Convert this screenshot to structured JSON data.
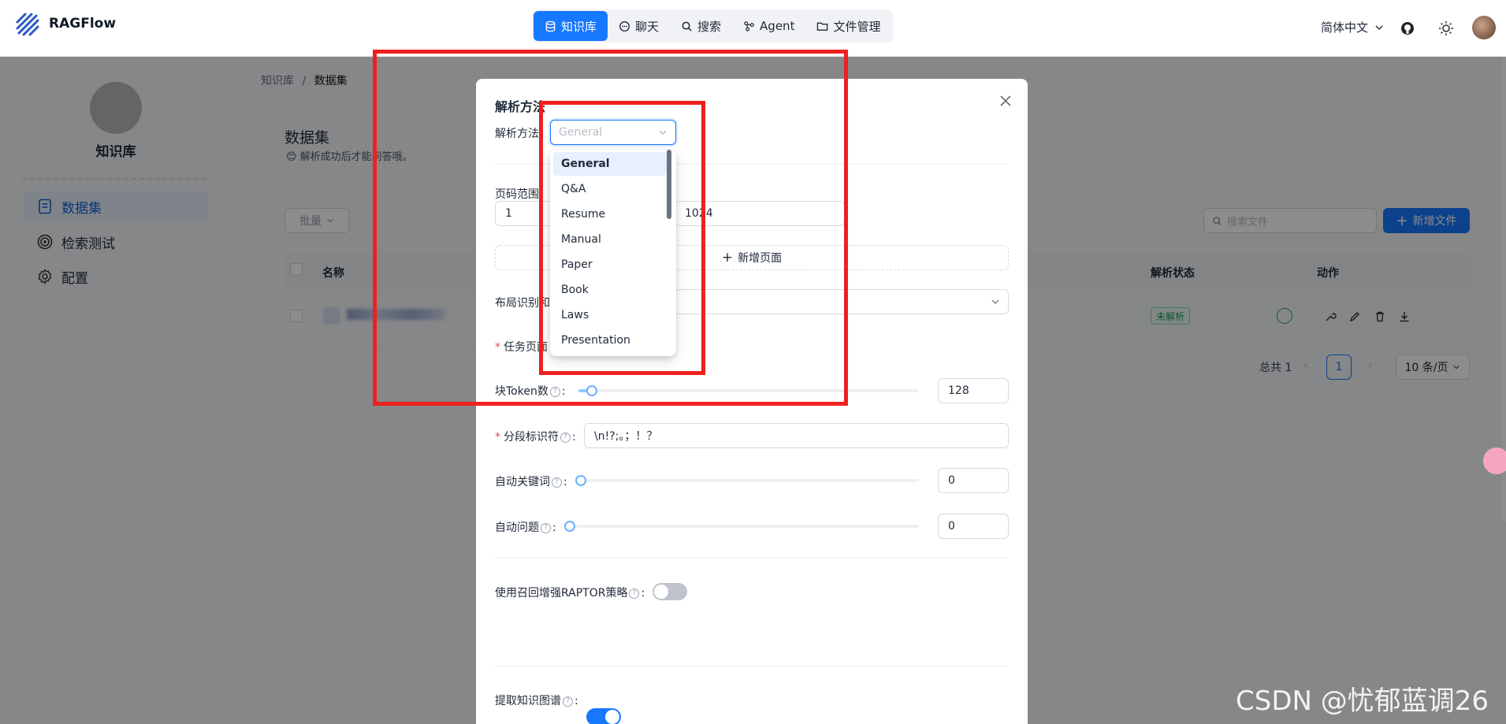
{
  "app": {
    "brand": "RAGFlow"
  },
  "nav": [
    {
      "label": "知识库",
      "icon": "database-icon",
      "active": true
    },
    {
      "label": "聊天",
      "icon": "chat-icon"
    },
    {
      "label": "搜索",
      "icon": "search-icon"
    },
    {
      "label": "Agent",
      "icon": "agent-icon"
    },
    {
      "label": "文件管理",
      "icon": "folder-icon"
    }
  ],
  "header": {
    "language": "简体中文"
  },
  "sidebar": {
    "kb_name": "知识库",
    "items": [
      {
        "label": "数据集",
        "icon": "document-icon",
        "active": true
      },
      {
        "label": "检索测试",
        "icon": "target-icon"
      },
      {
        "label": "配置",
        "icon": "gear-icon"
      }
    ]
  },
  "breadcrumb": {
    "root": "知识库",
    "sep": "/",
    "current": "数据集"
  },
  "dataset": {
    "title": "数据集",
    "tip": "😊 解析成功后才能问答哦。",
    "batch_label": "批量",
    "search_placeholder": "搜索文件",
    "add_label": "新增文件",
    "columns": {
      "name": "名称",
      "status": "解析状态",
      "action": "动作"
    },
    "rows": [
      {
        "status": "未解析"
      }
    ],
    "pagination": {
      "total": "总共 1",
      "current": "1",
      "per_page": "10 条/页"
    }
  },
  "modal": {
    "title": "解析方法",
    "method_label": "解析方法:",
    "method_placeholder": "General",
    "page_range_label": "页码范围",
    "page_from": "1",
    "page_to": "1024",
    "add_page_label": "新增页面",
    "layout_label": "布局识别和",
    "task_page_label": "任务页面",
    "chunk_token_label": "块Token数",
    "chunk_token_value": "128",
    "chunk_token_level": 0.04,
    "delimiter_label": "分段标识符",
    "delimiter_value": "\\n!?;。；！？",
    "auto_keyword_label": "自动关键词",
    "auto_keyword_value": "0",
    "auto_question_label": "自动问题",
    "auto_question_value": "0",
    "raptor_label": "使用召回增强RAPTOR策略",
    "raptor_on": false,
    "kg_label": "提取知识图谱",
    "kg_on": true
  },
  "dropdown": {
    "options": [
      "General",
      "Q&A",
      "Resume",
      "Manual",
      "Paper",
      "Book",
      "Laws",
      "Presentation"
    ],
    "selected": "General"
  },
  "watermark": "CSDN @忧郁蓝调26"
}
